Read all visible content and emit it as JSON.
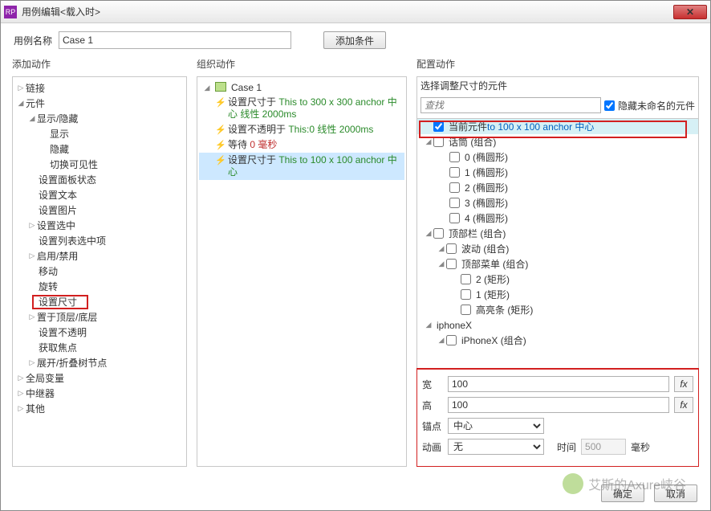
{
  "title": "用例编辑<载入时>",
  "titleIcon": "RP",
  "caseNameLabel": "用例名称",
  "caseName": "Case 1",
  "addConditionLabel": "添加条件",
  "colHeaders": {
    "left": "添加动作",
    "mid": "组织动作",
    "right": "配置动作"
  },
  "leftTree": {
    "links": "链接",
    "widgets": "元件",
    "showhide": "显示/隐藏",
    "show": "显示",
    "hide": "隐藏",
    "togglevis": "切换可见性",
    "panelstate": "设置面板状态",
    "settext": "设置文本",
    "setimage": "设置图片",
    "setselected": "设置选中",
    "selectedlist": "设置列表选中项",
    "enabledisable": "启用/禁用",
    "move": "移动",
    "rotate": "旋转",
    "setsize": "设置尺寸",
    "bringfront": "置于顶层/底层",
    "opacity": "设置不透明",
    "focus": "获取焦点",
    "expandtree": "展开/折叠树节点",
    "globalvar": "全局变量",
    "repeater": "中继器",
    "other": "其他"
  },
  "midCase": "Case 1",
  "midActions": [
    {
      "t": "设置尺寸于 ",
      "g": "This to 300 x 300 anchor 中心 线性 2000ms"
    },
    {
      "t": "设置不透明于 ",
      "g": "This:0 线性 2000ms"
    },
    {
      "t": "等待 ",
      "r": "0 毫秒"
    },
    {
      "t": "设置尺寸于 ",
      "g": "This to 100 x 100 anchor 中心",
      "sel": true
    }
  ],
  "rightHeader": "选择调整尺寸的元件",
  "searchPlaceholder": "查找",
  "hideUnnamed": "隐藏未命名的元件",
  "currentWidget": {
    "label": "当前元件",
    "b": " to 100 x 100 anchor 中心"
  },
  "wtree": {
    "huatong": "话筒 (组合)",
    "e0": "0 (椭圆形)",
    "e1": "1 (椭圆形)",
    "e2": "2 (椭圆形)",
    "e3": "3 (椭圆形)",
    "e4": "4 (椭圆形)",
    "topbar": "顶部栏 (组合)",
    "wave": "波动 (组合)",
    "topmenu": "顶部菜单 (组合)",
    "r2": "2 (矩形)",
    "r1": "1 (矩形)",
    "hl": "高亮条 (矩形)",
    "iphone": "iphoneX",
    "iphonex": "iPhoneX (组合)"
  },
  "cfg": {
    "wLabel": "宽",
    "wVal": "100",
    "hLabel": "高",
    "hVal": "100",
    "anchorLabel": "锚点",
    "anchorVal": "中心",
    "animLabel": "动画",
    "animVal": "无",
    "timeLabel": "时间",
    "timeVal": "500",
    "msLabel": "毫秒"
  },
  "fx": "fx",
  "okLabel": "确定",
  "cancelLabel": "取消",
  "watermark": "艾斯的Axure峡谷"
}
